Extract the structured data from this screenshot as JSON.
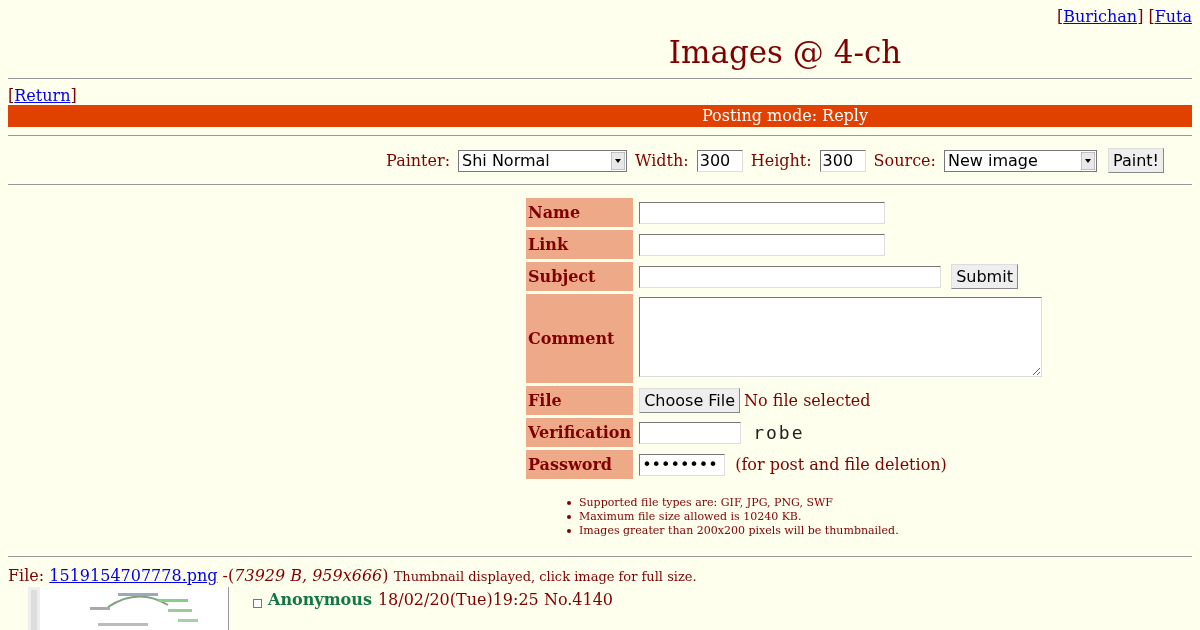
{
  "nav_links": [
    {
      "open": "[",
      "label": "Burichan",
      "close": "]"
    },
    {
      "open": "[",
      "label": "Futa"
    }
  ],
  "title": "Images @ 4-ch",
  "return_link": {
    "open": "[",
    "label": "Return",
    "close": "]"
  },
  "mode_bar": "Posting mode: Reply",
  "paint_form": {
    "painter_label": "Painter:",
    "painter_value": "Shi Normal",
    "width_label": "Width:",
    "width_value": "300",
    "height_label": "Height:",
    "height_value": "300",
    "source_label": "Source:",
    "source_value": "New image",
    "button": "Paint!"
  },
  "post_form": {
    "rows": [
      {
        "label": "Name",
        "kind": "text"
      },
      {
        "label": "Link",
        "kind": "text"
      },
      {
        "label": "Subject",
        "kind": "subject",
        "button": "Submit"
      },
      {
        "label": "Comment",
        "kind": "textarea"
      },
      {
        "label": "File",
        "kind": "file",
        "button": "Choose File",
        "status": "No file selected"
      },
      {
        "label": "Verification",
        "kind": "captcha",
        "captcha": "robe"
      },
      {
        "label": "Password",
        "kind": "password",
        "value": "••••••••",
        "note": "(for post and file deletion)"
      }
    ],
    "rules": [
      "Supported file types are: GIF, JPG, PNG, SWF",
      "Maximum file size allowed is 10240 KB.",
      "Images greater than 200x200 pixels will be thumbnailed."
    ]
  },
  "post": {
    "file_label": "File:",
    "file_name": "1519154707778.png",
    "file_info_open": "-(",
    "file_info": "73929 B, 959x666",
    "file_info_close": ")",
    "thumb_note": "Thumbnail displayed, click image for full size.",
    "checked": false,
    "name": "Anonymous",
    "date": "18/02/20(Tue)19:25 No.4140"
  }
}
